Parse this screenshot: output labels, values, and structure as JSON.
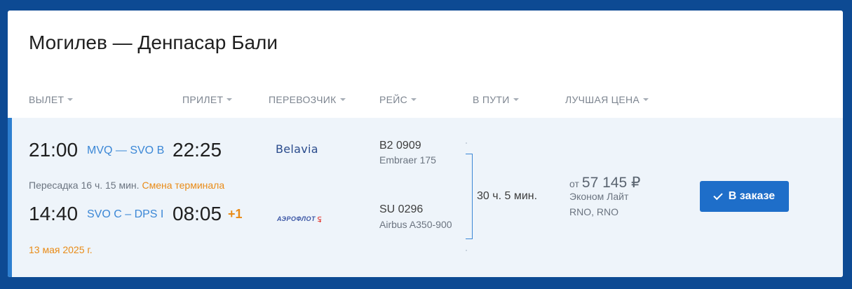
{
  "title": "Могилев — Денпасар Бали",
  "columns": {
    "departure": "ВЫЛЕТ",
    "arrival": "ПРИЛЕТ",
    "carrier": "ПЕРЕВОЗЧИК",
    "flight": "РЕЙС",
    "duration": "В ПУТИ",
    "best_price": "ЛУЧШАЯ ЦЕНА"
  },
  "segments": [
    {
      "dep_time": "21:00",
      "route": "MVQ — SVO B",
      "arr_time": "22:25",
      "carrier": "Belavia",
      "flight_no": "B2 0909",
      "aircraft": "Embraer 175"
    },
    {
      "dep_time": "14:40",
      "route": "SVO C – DPS I",
      "arr_time": "08:05",
      "day_shift": "+1",
      "carrier": "АЭРОФЛОТ",
      "flight_no": "SU 0296",
      "aircraft": "Airbus A350-900"
    }
  ],
  "transfer": {
    "text": "Пересадка 16 ч. 15 мин.",
    "note": "Смена терминала"
  },
  "date": "13 мая 2025 г.",
  "total_duration": "30 ч. 5 мин.",
  "price": {
    "prefix": "от",
    "amount": "57 145 ₽",
    "fare": "Эконом Лайт",
    "codes": "RNO, RNO"
  },
  "order_button": "В заказе",
  "colors": {
    "background": "#0d4a93",
    "accent": "#3b87d6",
    "button": "#1e6ec9",
    "warning": "#e98b17"
  }
}
